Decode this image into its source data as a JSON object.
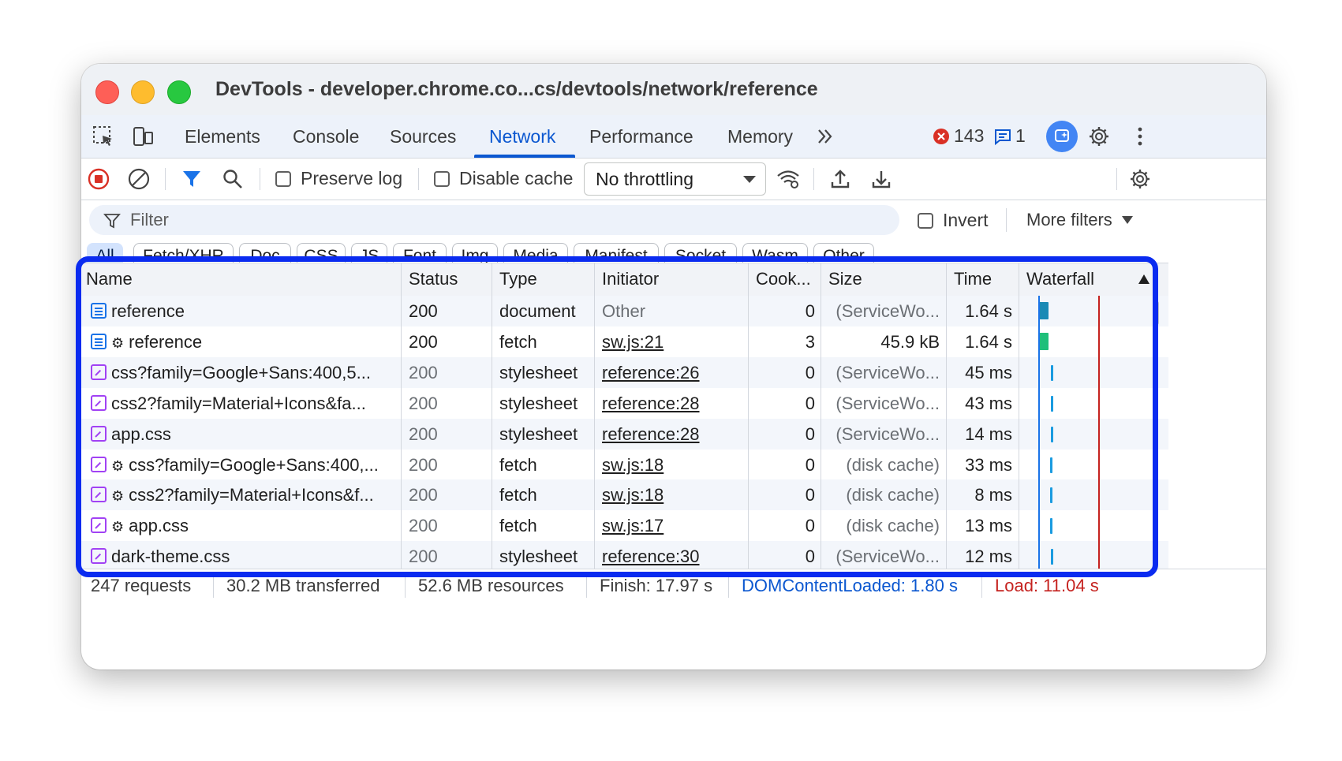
{
  "window": {
    "title": "DevTools - developer.chrome.co...cs/devtools/network/reference"
  },
  "tabs": {
    "items": [
      "Elements",
      "Console",
      "Sources",
      "Network",
      "Performance",
      "Memory"
    ],
    "active": "Network",
    "errors_count": "143",
    "messages_count": "1"
  },
  "toolbar": {
    "preserve_log": "Preserve log",
    "disable_cache": "Disable cache",
    "throttling": "No throttling"
  },
  "filter": {
    "placeholder": "Filter",
    "invert": "Invert",
    "more_filters": "More filters"
  },
  "chips": [
    "All",
    "Fetch/XHR",
    "Doc",
    "CSS",
    "JS",
    "Font",
    "Img",
    "Media",
    "Manifest",
    "Socket",
    "Wasm",
    "Other"
  ],
  "table": {
    "headers": [
      "Name",
      "Status",
      "Type",
      "Initiator",
      "Cook...",
      "Size",
      "Time",
      "Waterfall"
    ],
    "rows": [
      {
        "icon": "doc",
        "sw": false,
        "name": "reference",
        "status": "200",
        "status_gray": false,
        "type": "document",
        "initiator": "Other",
        "initiator_link": false,
        "cookies": "0",
        "size": "(ServiceWo...",
        "size_gray": true,
        "time": "1.64 s",
        "wf_pos": 0.12,
        "wf_len": 0.08,
        "wf_color": "#1a8ab5"
      },
      {
        "icon": "doc",
        "sw": true,
        "name": "reference",
        "status": "200",
        "status_gray": false,
        "type": "fetch",
        "initiator": "sw.js:21",
        "initiator_link": true,
        "cookies": "3",
        "size": "45.9 kB",
        "size_gray": false,
        "time": "1.64 s",
        "wf_pos": 0.12,
        "wf_len": 0.08,
        "wf_color": "#1fbf7a"
      },
      {
        "icon": "css",
        "sw": false,
        "name": "css?family=Google+Sans:400,5...",
        "status": "200",
        "status_gray": true,
        "type": "stylesheet",
        "initiator": "reference:26",
        "initiator_link": true,
        "cookies": "0",
        "size": "(ServiceWo...",
        "size_gray": true,
        "time": "45 ms",
        "wf_pos": 0.22,
        "wf_len": 0.02,
        "wf_color": "#1a9be0"
      },
      {
        "icon": "css",
        "sw": false,
        "name": "css2?family=Material+Icons&fa...",
        "status": "200",
        "status_gray": true,
        "type": "stylesheet",
        "initiator": "reference:28",
        "initiator_link": true,
        "cookies": "0",
        "size": "(ServiceWo...",
        "size_gray": true,
        "time": "43 ms",
        "wf_pos": 0.22,
        "wf_len": 0.02,
        "wf_color": "#1a9be0"
      },
      {
        "icon": "css",
        "sw": false,
        "name": "app.css",
        "status": "200",
        "status_gray": true,
        "type": "stylesheet",
        "initiator": "reference:28",
        "initiator_link": true,
        "cookies": "0",
        "size": "(ServiceWo...",
        "size_gray": true,
        "time": "14 ms",
        "wf_pos": 0.22,
        "wf_len": 0.02,
        "wf_color": "#1a9be0"
      },
      {
        "icon": "css",
        "sw": true,
        "name": "css?family=Google+Sans:400,...",
        "status": "200",
        "status_gray": true,
        "type": "fetch",
        "initiator": "sw.js:18",
        "initiator_link": true,
        "cookies": "0",
        "size": "(disk cache)",
        "size_gray": true,
        "time": "33 ms",
        "wf_pos": 0.21,
        "wf_len": 0.02,
        "wf_color": "#1a9be0"
      },
      {
        "icon": "css",
        "sw": true,
        "name": "css2?family=Material+Icons&f...",
        "status": "200",
        "status_gray": true,
        "type": "fetch",
        "initiator": "sw.js:18",
        "initiator_link": true,
        "cookies": "0",
        "size": "(disk cache)",
        "size_gray": true,
        "time": "8 ms",
        "wf_pos": 0.21,
        "wf_len": 0.02,
        "wf_color": "#1a9be0"
      },
      {
        "icon": "css",
        "sw": true,
        "name": "app.css",
        "status": "200",
        "status_gray": true,
        "type": "fetch",
        "initiator": "sw.js:17",
        "initiator_link": true,
        "cookies": "0",
        "size": "(disk cache)",
        "size_gray": true,
        "time": "13 ms",
        "wf_pos": 0.21,
        "wf_len": 0.02,
        "wf_color": "#1a9be0"
      },
      {
        "icon": "css",
        "sw": false,
        "name": "dark-theme.css",
        "status": "200",
        "status_gray": true,
        "type": "stylesheet",
        "initiator": "reference:30",
        "initiator_link": true,
        "cookies": "0",
        "size": "(ServiceWo...",
        "size_gray": true,
        "time": "12 ms",
        "wf_pos": 0.22,
        "wf_len": 0.02,
        "wf_color": "#1a9be0"
      }
    ]
  },
  "statusbar": {
    "requests": "247 requests",
    "transferred": "30.2 MB transferred",
    "resources": "52.6 MB resources",
    "finish": "Finish: 17.97 s",
    "dom_content_loaded": "DOMContentLoaded: 1.80 s",
    "load": "Load: 11.04 s"
  },
  "colors": {
    "accent": "#0b57d0",
    "highlight": "#0a2bf0",
    "record": "#d93025"
  }
}
